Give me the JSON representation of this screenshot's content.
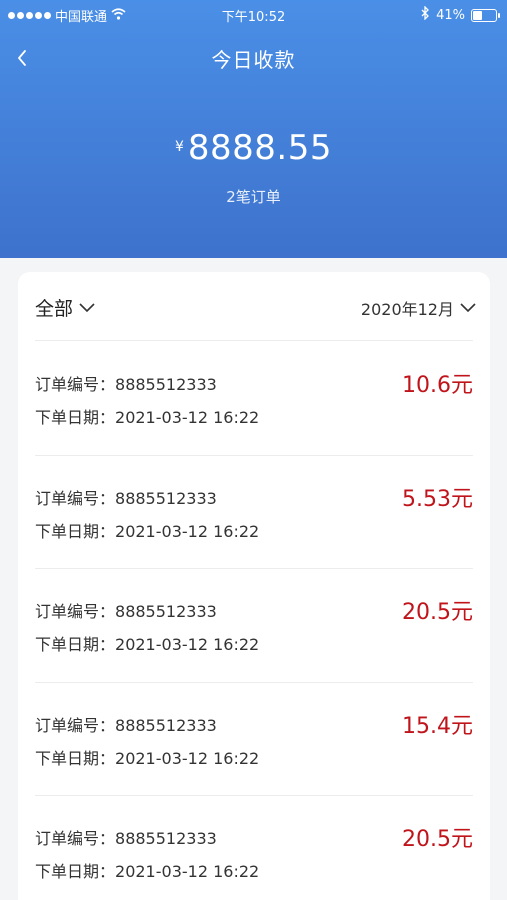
{
  "status_bar": {
    "carrier": "中国联通",
    "time": "下午10:52",
    "battery_percent_label": "41%",
    "battery_level": 0.41
  },
  "nav": {
    "title": "今日收款"
  },
  "summary": {
    "currency": "¥",
    "amount": "8888.55",
    "order_count": "2笔订单"
  },
  "filters": {
    "category": "全部",
    "month": "2020年12月"
  },
  "order_labels": {
    "number": "订单编号：",
    "date": "下单日期："
  },
  "orders": [
    {
      "number": "8885512333",
      "date": "2021-03-12 16:22",
      "price": "10.6元"
    },
    {
      "number": "8885512333",
      "date": "2021-03-12 16:22",
      "price": "5.53元"
    },
    {
      "number": "8885512333",
      "date": "2021-03-12 16:22",
      "price": "20.5元"
    },
    {
      "number": "8885512333",
      "date": "2021-03-12 16:22",
      "price": "15.4元"
    },
    {
      "number": "8885512333",
      "date": "2021-03-12 16:22",
      "price": "20.5元"
    }
  ],
  "colors": {
    "header_top": "#4a8fe7",
    "header_bottom": "#3e72cc",
    "price": "#c0141b",
    "background": "#f4f5f7"
  }
}
